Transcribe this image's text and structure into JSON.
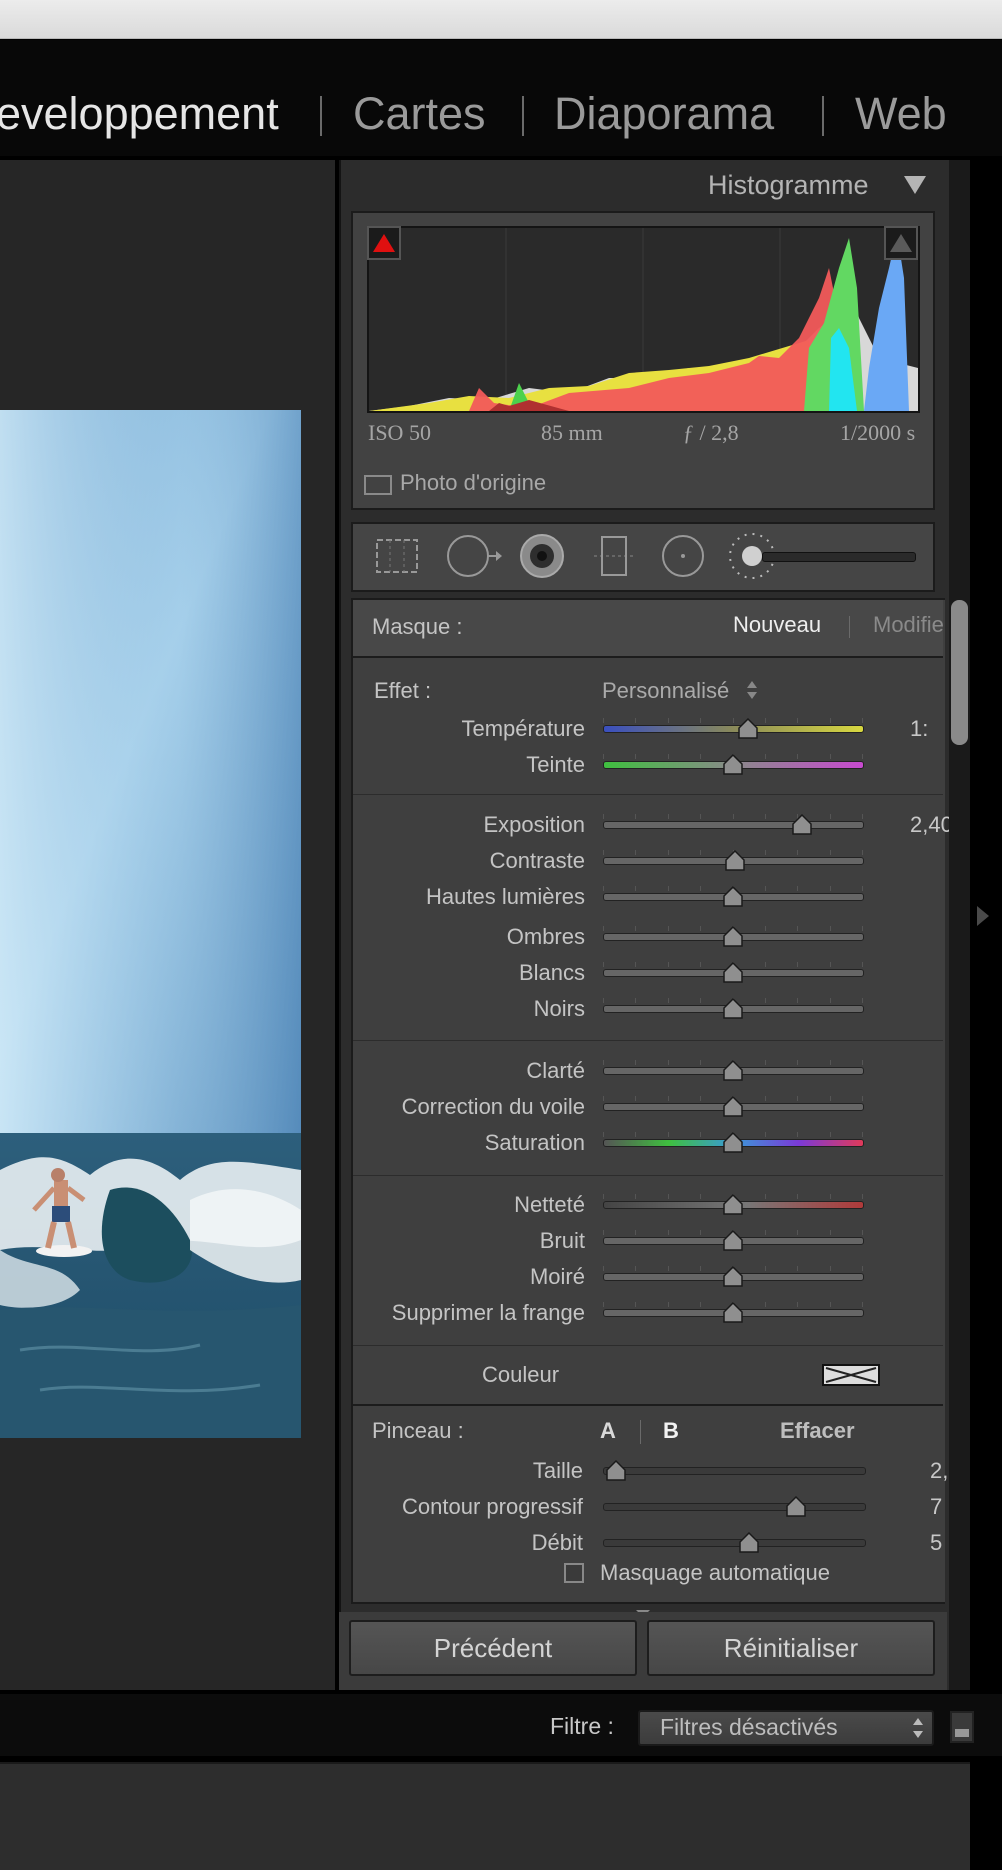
{
  "modules": {
    "items": [
      {
        "label": "eveloppement",
        "active": true
      },
      {
        "label": "Cartes",
        "active": false
      },
      {
        "label": "Diaporama",
        "active": false
      },
      {
        "label": "Web",
        "active": false
      }
    ]
  },
  "histogram": {
    "title": "Histogramme",
    "iso": "ISO 50",
    "focal": "85 mm",
    "aperture": "ƒ / 2,8",
    "shutter": "1/2000 s",
    "original_photo_label": "Photo d'origine"
  },
  "mask": {
    "label": "Masque :",
    "new_label": "Nouveau",
    "edit_label": "Modifie"
  },
  "effect": {
    "label": "Effet :",
    "preset": "Personnalisé"
  },
  "sliders": [
    {
      "label": "Température",
      "value": "1:",
      "pos": 0.56
    },
    {
      "label": "Teinte",
      "value": "",
      "pos": 0.5
    },
    {
      "label": "Exposition",
      "value": "2,40",
      "pos": 0.77
    },
    {
      "label": "Contraste",
      "value": "",
      "pos": 0.51
    },
    {
      "label": "Hautes lumières",
      "value": "",
      "pos": 0.5
    },
    {
      "label": "Ombres",
      "value": "",
      "pos": 0.5
    },
    {
      "label": "Blancs",
      "value": "",
      "pos": 0.5
    },
    {
      "label": "Noirs",
      "value": "",
      "pos": 0.5
    },
    {
      "label": "Clarté",
      "value": "",
      "pos": 0.5
    },
    {
      "label": "Correction du voile",
      "value": "",
      "pos": 0.5
    },
    {
      "label": "Saturation",
      "value": "",
      "pos": 0.5
    },
    {
      "label": "Netteté",
      "value": "",
      "pos": 0.5
    },
    {
      "label": "Bruit",
      "value": "",
      "pos": 0.5
    },
    {
      "label": "Moiré",
      "value": "",
      "pos": 0.5
    },
    {
      "label": "Supprimer la frange",
      "value": "",
      "pos": 0.5
    }
  ],
  "color": {
    "label": "Couleur"
  },
  "brush": {
    "label": "Pinceau :",
    "a": "A",
    "b": "B",
    "erase": "Effacer",
    "sliders": [
      {
        "label": "Taille",
        "value": "2,",
        "pos": 0.05
      },
      {
        "label": "Contour progressif",
        "value": "7",
        "pos": 0.74
      },
      {
        "label": "Débit",
        "value": "5",
        "pos": 0.56
      }
    ],
    "automask_label": "Masquage automatique"
  },
  "buttons": {
    "previous": "Précédent",
    "reset": "Réinitialiser"
  },
  "filter": {
    "label": "Filtre :",
    "value": "Filtres désactivés"
  },
  "colors": {
    "accent_bg": "#3f3f3f",
    "panel_border": "#1b1b1b"
  }
}
